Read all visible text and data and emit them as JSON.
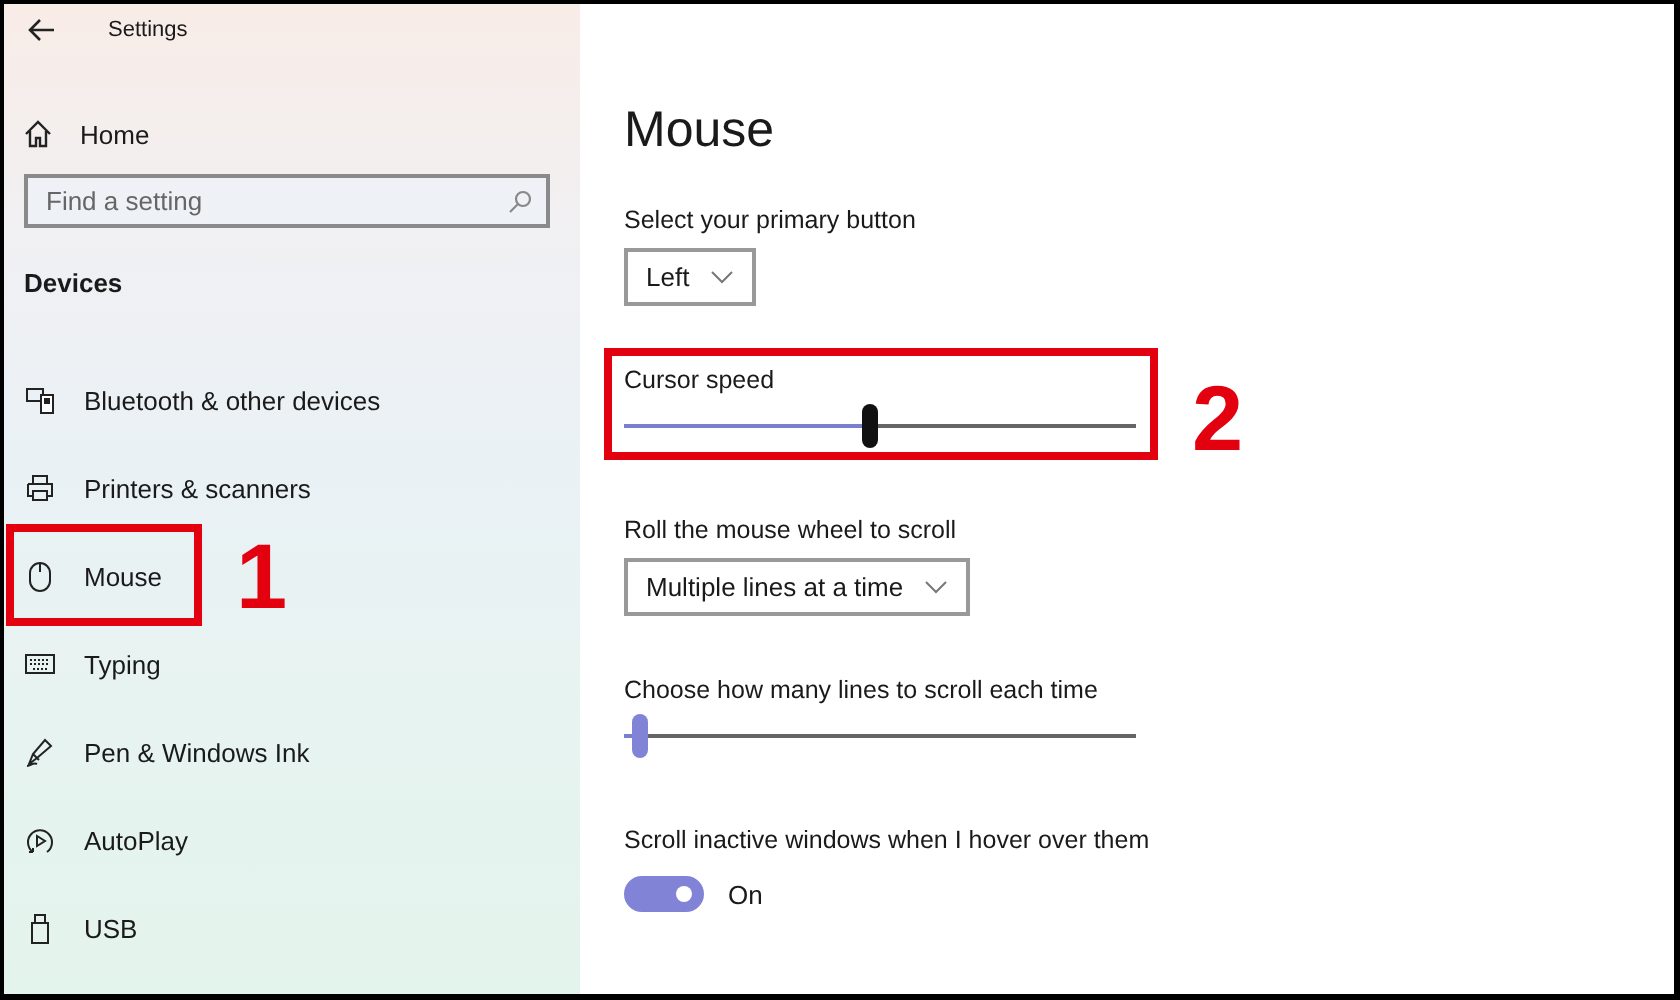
{
  "window": {
    "title": "Settings"
  },
  "sidebar": {
    "home": "Home",
    "search": {
      "placeholder": "Find a setting"
    },
    "category": "Devices",
    "items": [
      {
        "label": "Bluetooth & other devices",
        "kind": "bluetooth"
      },
      {
        "label": "Printers & scanners",
        "kind": "printer"
      },
      {
        "label": "Mouse",
        "kind": "mouse",
        "annotation": "1"
      },
      {
        "label": "Typing",
        "kind": "keyboard"
      },
      {
        "label": "Pen & Windows Ink",
        "kind": "pen"
      },
      {
        "label": "AutoPlay",
        "kind": "autoplay"
      },
      {
        "label": "USB",
        "kind": "usb"
      }
    ]
  },
  "page": {
    "title": "Mouse",
    "settings": [
      {
        "kind": "dropdown",
        "label": "Select your primary button",
        "value": "Left"
      },
      {
        "kind": "slider",
        "label": "Cursor speed",
        "level": 0.48,
        "hovered": true,
        "annotation": "2"
      },
      {
        "kind": "dropdown",
        "label": "Roll the mouse wheel to scroll",
        "value": "Multiple lines at a time"
      },
      {
        "kind": "slider",
        "label": "Choose how many lines to scroll each time",
        "level": 0.03,
        "hovered": false
      },
      {
        "kind": "toggle",
        "label": "Scroll inactive windows when I hover over them",
        "on": true,
        "state": "On"
      }
    ]
  }
}
